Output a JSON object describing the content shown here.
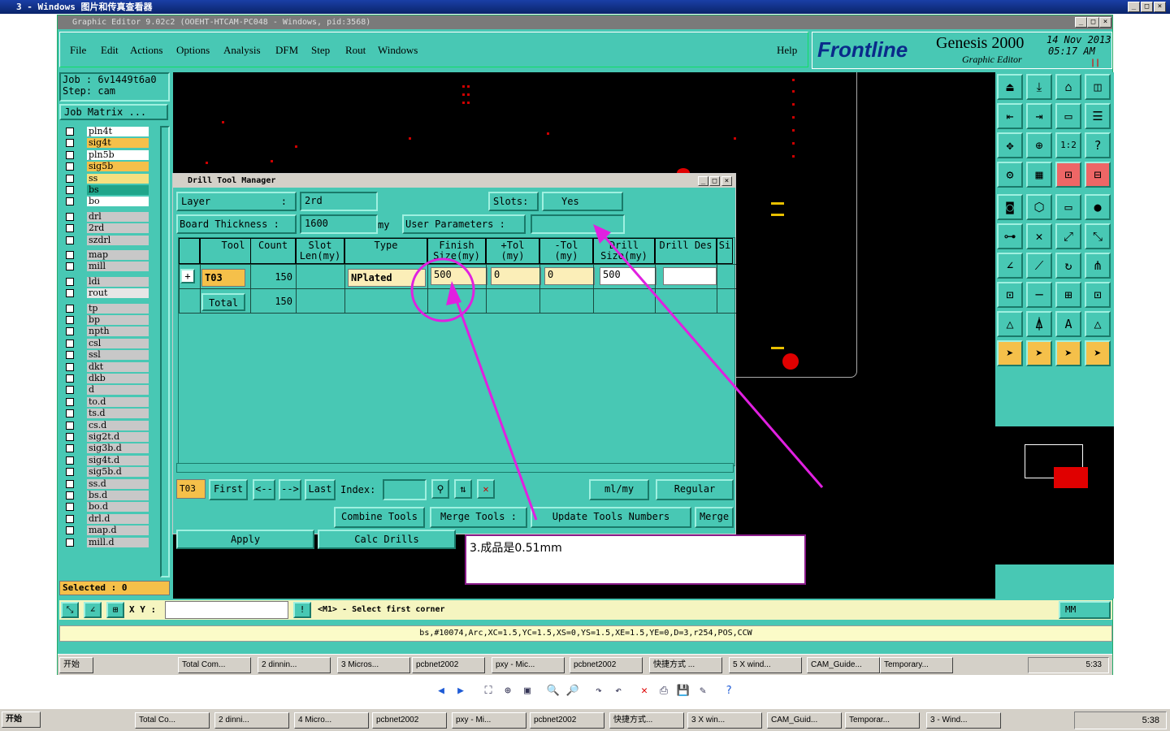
{
  "outer_window": {
    "title": "3 - Windows 图片和传真查看器"
  },
  "genesis": {
    "title": "Graphic Editor 9.02c2 (OOEHT-HTCAM-PC048 - Windows, pid:3568)",
    "menu": [
      "File",
      "Edit",
      "Actions",
      "Options",
      "Analysis",
      "DFM",
      "Step",
      "Rout",
      "Windows"
    ],
    "help": "Help",
    "brand": "Frontline",
    "product": "Genesis 2000",
    "subtitle": "Graphic Editor",
    "date": "14 Nov 2013",
    "time": "05:17 AM",
    "job_label": "Job : 6v1449t6a0",
    "step_label": "Step: cam",
    "job_matrix": "Job Matrix ...",
    "selected": "Selected : 0",
    "layers": [
      {
        "name": "pln4t",
        "color": "#ffffff"
      },
      {
        "name": "sig4t",
        "color": "#f5c04a"
      },
      {
        "name": "pln5b",
        "color": "#ffffff"
      },
      {
        "name": "sig5b",
        "color": "#f5c04a"
      },
      {
        "name": "ss",
        "color": "#f5e080"
      },
      {
        "name": "bs",
        "color": "#1fa58a"
      },
      {
        "name": "bo",
        "color": "#ffffff"
      },
      {
        "name": "drl",
        "color": "#c8c8c8"
      },
      {
        "name": "2rd",
        "color": "#c8c8c8"
      },
      {
        "name": "szdrl",
        "color": "#c8c8c8"
      },
      {
        "name": "map",
        "color": "#c8c8c8"
      },
      {
        "name": "mill",
        "color": "#c8c8c8"
      },
      {
        "name": "ldi",
        "color": "#c8c8c8"
      },
      {
        "name": "rout",
        "color": "#e6e6e6"
      },
      {
        "name": "tp",
        "color": "#c8c8c8"
      },
      {
        "name": "bp",
        "color": "#c8c8c8"
      },
      {
        "name": "npth",
        "color": "#c8c8c8"
      },
      {
        "name": "csl",
        "color": "#c8c8c8"
      },
      {
        "name": "ssl",
        "color": "#c8c8c8"
      },
      {
        "name": "dkt",
        "color": "#c8c8c8"
      },
      {
        "name": "dkb",
        "color": "#c8c8c8"
      },
      {
        "name": "d",
        "color": "#c8c8c8"
      },
      {
        "name": "to.d",
        "color": "#c8c8c8"
      },
      {
        "name": "ts.d",
        "color": "#c8c8c8"
      },
      {
        "name": "cs.d",
        "color": "#c8c8c8"
      },
      {
        "name": "sig2t.d",
        "color": "#c8c8c8"
      },
      {
        "name": "sig3b.d",
        "color": "#c8c8c8"
      },
      {
        "name": "sig4t.d",
        "color": "#c8c8c8"
      },
      {
        "name": "sig5b.d",
        "color": "#c8c8c8"
      },
      {
        "name": "ss.d",
        "color": "#c8c8c8"
      },
      {
        "name": "bs.d",
        "color": "#c8c8c8"
      },
      {
        "name": "bo.d",
        "color": "#c8c8c8"
      },
      {
        "name": "drl.d",
        "color": "#c8c8c8"
      },
      {
        "name": "map.d",
        "color": "#c8c8c8"
      },
      {
        "name": "mill.d",
        "color": "#c8c8c8"
      }
    ],
    "xy_label": "X Y :",
    "prompt": "<M1> - Select first corner",
    "units": "MM",
    "status_line": "bs,#10074,Arc,XC=1.5,YC=1.5,XS=0,YS=1.5,XE=1.5,YE=0,D=3,r254,POS,CCW"
  },
  "dialog": {
    "title": "Drill Tool Manager",
    "layer_label": "Layer",
    ":": ":",
    "layer_value": "2rd",
    "slots_label": "Slots:",
    "slots_value": "Yes",
    "board_thickness_label": "Board Thickness :",
    "board_thickness_value": "1600",
    "board_unit": "my",
    "user_params_label": "User Parameters :",
    "columns": [
      "Tool",
      "Count",
      "Slot Len(my)",
      "Type",
      "Finish Size(my)",
      "+Tol (my)",
      "-Tol (my)",
      "Drill Size(my)",
      "Drill Des",
      "Si"
    ],
    "row": {
      "tool": "T03",
      "count": "150",
      "type": "NPlated",
      "finish": "500",
      "ptol": "0",
      "mtol": "0",
      "drill": "500"
    },
    "total": {
      "label": "Total",
      "count": "150"
    },
    "bottom_tool": "T03",
    "first": "First",
    "prev": "<--",
    "next": "-->",
    "last": "Last",
    "index_label": "Index:",
    "units": "ml/my",
    "mode": "Regular",
    "combine": "Combine Tools",
    "merge_tools": "Merge Tools :",
    "update": "Update Tools Numbers",
    "merge": "Merge",
    "apply": "Apply",
    "calc": "Calc Drills"
  },
  "annotation": {
    "text": "3.成品是0.51mm"
  },
  "inner_taskbar": {
    "start": "开始",
    "items": [
      "Total Com...",
      "2 dinnin...",
      "3 Micros...",
      "pcbnet2002",
      "pxy - Mic...",
      "pcbnet2002",
      "快捷方式 ...",
      "5 X wind...",
      "CAM_Guide...",
      "Temporary..."
    ],
    "clock": "5:33"
  },
  "viewer_toolbar": {
    "icons": [
      "prev-icon",
      "next-icon",
      "best-fit-icon",
      "actual-size-icon",
      "slideshow-icon",
      "zoom-in-icon",
      "zoom-out-icon",
      "rotate-cw-icon",
      "rotate-ccw-icon",
      "delete-icon",
      "print-icon",
      "save-icon",
      "edit-icon",
      "help-icon"
    ]
  },
  "taskbar": {
    "start": "开始",
    "items": [
      "Total Co...",
      "2 dinni...",
      "4 Micro...",
      "pcbnet2002",
      "pxy - Mi...",
      "pcbnet2002",
      "快捷方式...",
      "3 X win...",
      "CAM_Guid...",
      "Temporar...",
      "3 - Wind..."
    ],
    "clock": "5:38"
  }
}
